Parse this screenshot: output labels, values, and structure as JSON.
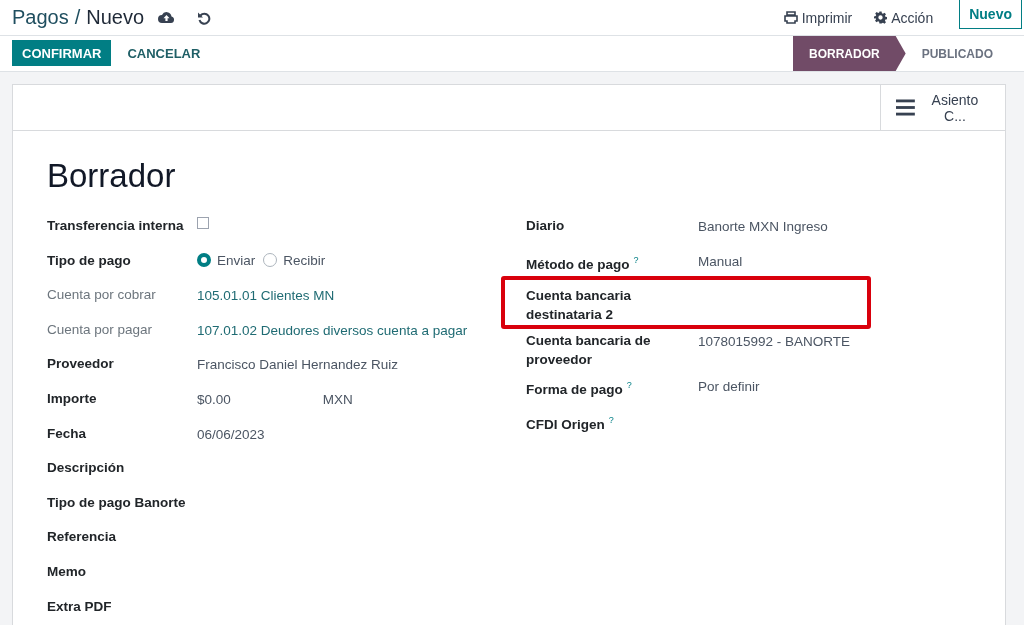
{
  "breadcrumb": {
    "parent": "Pagos",
    "separator": "/",
    "current": "Nuevo"
  },
  "header_actions": [
    {
      "label": "Imprimir",
      "kind": "print"
    },
    {
      "label": "Acción",
      "kind": "gear"
    }
  ],
  "new_button": "Nuevo",
  "buttons": [
    {
      "label": "CONFIRMAR",
      "kind": "primary"
    },
    {
      "label": "CANCELAR",
      "kind": "secondary"
    }
  ],
  "status_steps": [
    {
      "label": "BORRADOR",
      "selected": true
    },
    {
      "label": "PUBLICADO",
      "selected": false
    }
  ],
  "smart_button": "Asiento C...",
  "title": "Borrador",
  "left_fields": [
    {
      "label": "Transferencia interna",
      "muted": false,
      "kind": "checkbox",
      "checked": false
    },
    {
      "label": "Tipo de pago",
      "muted": false,
      "kind": "radio",
      "options": [
        {
          "label": "Enviar",
          "selected": true
        },
        {
          "label": "Recibir",
          "selected": false
        }
      ]
    },
    {
      "label": "Cuenta por cobrar",
      "muted": true,
      "kind": "link",
      "value": "105.01.01 Clientes MN"
    },
    {
      "label": "Cuenta por pagar",
      "muted": true,
      "kind": "link",
      "value": "107.01.02 Deudores diversos cuenta a pagar"
    },
    {
      "label": "Proveedor",
      "muted": false,
      "kind": "text",
      "value": "Francisco Daniel Hernandez Ruiz"
    },
    {
      "label": "Importe",
      "muted": false,
      "kind": "amount",
      "value": "$0.00",
      "currency": "MXN"
    },
    {
      "label": "Fecha",
      "muted": false,
      "kind": "text",
      "value": "06/06/2023"
    },
    {
      "label": "Descripción",
      "muted": false,
      "kind": "empty"
    },
    {
      "label": "Tipo de pago Banorte",
      "muted": false,
      "kind": "empty"
    },
    {
      "label": "Referencia",
      "muted": false,
      "kind": "empty"
    },
    {
      "label": "Memo",
      "muted": false,
      "kind": "empty"
    },
    {
      "label": "Extra PDF",
      "muted": false,
      "kind": "empty"
    }
  ],
  "right_fields": [
    {
      "label": "Diario",
      "value": "Banorte MXN Ingreso",
      "highlighted": false
    },
    {
      "label": "Método de pago",
      "help": "?",
      "value": "Manual",
      "highlighted": false
    },
    {
      "label": "Cuenta bancaria destinataria 2",
      "highlighted": true
    },
    {
      "label": "Cuenta bancaria de proveedor",
      "value": "1078015992 - BANORTE",
      "highlighted": false
    },
    {
      "label": "Forma de pago",
      "help": "?",
      "value": "Por definir",
      "highlighted": false
    },
    {
      "label": "CFDI Origen",
      "help": "?",
      "highlighted": false
    }
  ]
}
